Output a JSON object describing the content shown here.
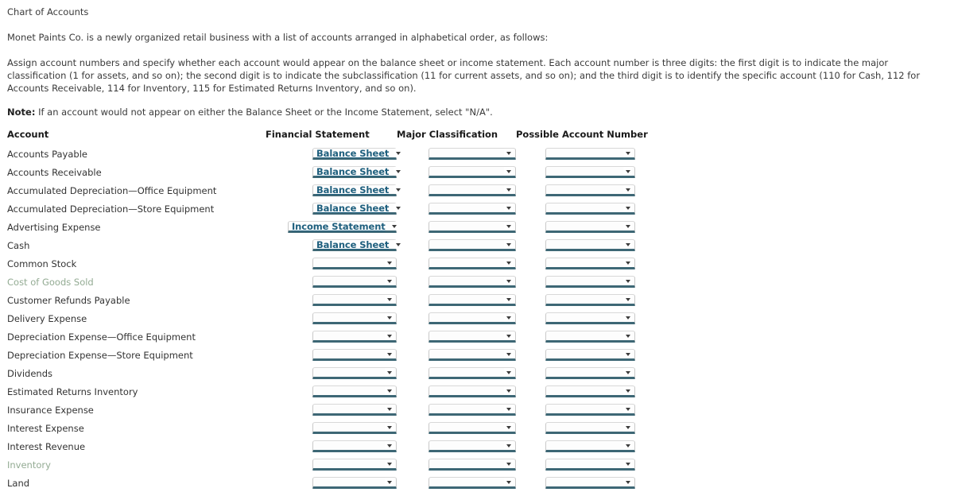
{
  "intro": {
    "title": "Chart of Accounts",
    "paragraph1": "Monet Paints Co. is a newly organized retail business with a list of accounts arranged in alphabetical order, as follows:",
    "paragraph2": "Assign account numbers and specify whether each account would appear on the balance sheet or income statement. Each account number is three digits: the first digit is to indicate the major classification (1 for assets, and so on); the second digit is to indicate the subclassification (11 for current assets, and so on); and the third digit is to identify the specific account (110 for Cash, 112 for Accounts Receivable, 114 for Inventory, 115 for Estimated Returns Inventory, and so on).",
    "note_label": "Note:",
    "note_text": "If an account would not appear on either the Balance Sheet or the Income Statement, select \"N/A\"."
  },
  "table": {
    "headers": {
      "account": "Account",
      "financial_statement": "Financial Statement",
      "major_classification": "Major Classification",
      "possible_account_number": "Possible Account Number"
    },
    "rows": [
      {
        "account": "Accounts Payable",
        "muted": false,
        "financial_statement": "Balance Sheet",
        "fs_width": "w-bs",
        "major_classification": "",
        "possible_account_number": ""
      },
      {
        "account": "Accounts Receivable",
        "muted": false,
        "financial_statement": "Balance Sheet",
        "fs_width": "w-bs",
        "major_classification": "",
        "possible_account_number": ""
      },
      {
        "account": "Accumulated Depreciation—Office Equipment",
        "muted": false,
        "financial_statement": "Balance Sheet",
        "fs_width": "w-bs",
        "major_classification": "",
        "possible_account_number": ""
      },
      {
        "account": "Accumulated Depreciation—Store Equipment",
        "muted": false,
        "financial_statement": "Balance Sheet",
        "fs_width": "w-bs",
        "major_classification": "",
        "possible_account_number": ""
      },
      {
        "account": "Advertising Expense",
        "muted": false,
        "financial_statement": "Income Statement",
        "fs_width": "w-is",
        "major_classification": "",
        "possible_account_number": ""
      },
      {
        "account": "Cash",
        "muted": false,
        "financial_statement": "Balance Sheet",
        "fs_width": "w-bs",
        "major_classification": "",
        "possible_account_number": ""
      },
      {
        "account": "Common Stock",
        "muted": false,
        "financial_statement": "",
        "fs_width": "w-e1",
        "major_classification": "",
        "possible_account_number": ""
      },
      {
        "account": "Cost of Goods Sold",
        "muted": true,
        "financial_statement": "",
        "fs_width": "w-e1",
        "major_classification": "",
        "possible_account_number": ""
      },
      {
        "account": "Customer Refunds Payable",
        "muted": false,
        "financial_statement": "",
        "fs_width": "w-e1",
        "major_classification": "",
        "possible_account_number": ""
      },
      {
        "account": "Delivery Expense",
        "muted": false,
        "financial_statement": "",
        "fs_width": "w-e1",
        "major_classification": "",
        "possible_account_number": ""
      },
      {
        "account": "Depreciation Expense—Office Equipment",
        "muted": false,
        "financial_statement": "",
        "fs_width": "w-e1",
        "major_classification": "",
        "possible_account_number": ""
      },
      {
        "account": "Depreciation Expense—Store Equipment",
        "muted": false,
        "financial_statement": "",
        "fs_width": "w-e1",
        "major_classification": "",
        "possible_account_number": ""
      },
      {
        "account": "Dividends",
        "muted": false,
        "financial_statement": "",
        "fs_width": "w-e1",
        "major_classification": "",
        "possible_account_number": ""
      },
      {
        "account": "Estimated Returns Inventory",
        "muted": false,
        "financial_statement": "",
        "fs_width": "w-e1",
        "major_classification": "",
        "possible_account_number": ""
      },
      {
        "account": "Insurance Expense",
        "muted": false,
        "financial_statement": "",
        "fs_width": "w-e1",
        "major_classification": "",
        "possible_account_number": ""
      },
      {
        "account": "Interest Expense",
        "muted": false,
        "financial_statement": "",
        "fs_width": "w-e1",
        "major_classification": "",
        "possible_account_number": ""
      },
      {
        "account": "Interest Revenue",
        "muted": false,
        "financial_statement": "",
        "fs_width": "w-e1",
        "major_classification": "",
        "possible_account_number": ""
      },
      {
        "account": "Inventory",
        "muted": true,
        "financial_statement": "",
        "fs_width": "w-e1",
        "major_classification": "",
        "possible_account_number": ""
      },
      {
        "account": "Land",
        "muted": false,
        "financial_statement": "",
        "fs_width": "w-e1",
        "major_classification": "",
        "possible_account_number": ""
      }
    ]
  },
  "colors": {
    "dropdown_text": "#1e5f7e",
    "dropdown_underline": "#3d6775",
    "muted_text": "#93ab93",
    "body_text": "#333333"
  },
  "icons": {
    "dropdown_arrow": "chevron-down-icon"
  }
}
